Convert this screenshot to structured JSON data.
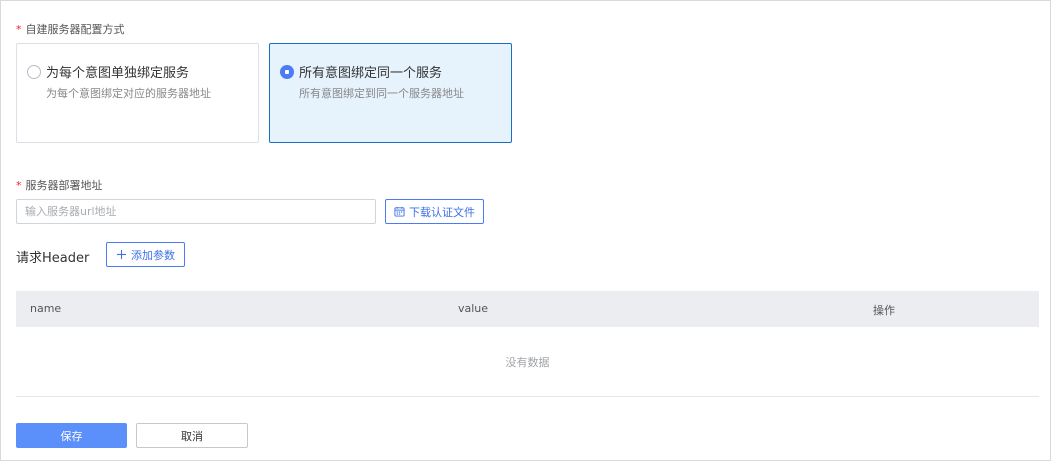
{
  "form": {
    "config_mode": {
      "label": "自建服务器配置方式",
      "options": [
        {
          "title": "为每个意图单独绑定服务",
          "desc": "为每个意图绑定对应的服务器地址",
          "selected": false
        },
        {
          "title": "所有意图绑定同一个服务",
          "desc": "所有意图绑定到同一个服务器地址",
          "selected": true
        }
      ]
    },
    "server_address": {
      "label": "服务器部署地址",
      "placeholder": "输入服务器url地址",
      "value": "",
      "download_button": "下载认证文件"
    },
    "header": {
      "title": "请求Header",
      "add_button": "添加参数",
      "table": {
        "columns": [
          "name",
          "value",
          "操作"
        ],
        "rows": [],
        "empty_text": "没有数据"
      }
    },
    "actions": {
      "save": "保存",
      "cancel": "取消"
    }
  },
  "colors": {
    "primary": "#5b8ff9",
    "selected_bg": "#e6f2fc",
    "selected_border": "#1a6fc4",
    "required_star": "#f5222d"
  }
}
